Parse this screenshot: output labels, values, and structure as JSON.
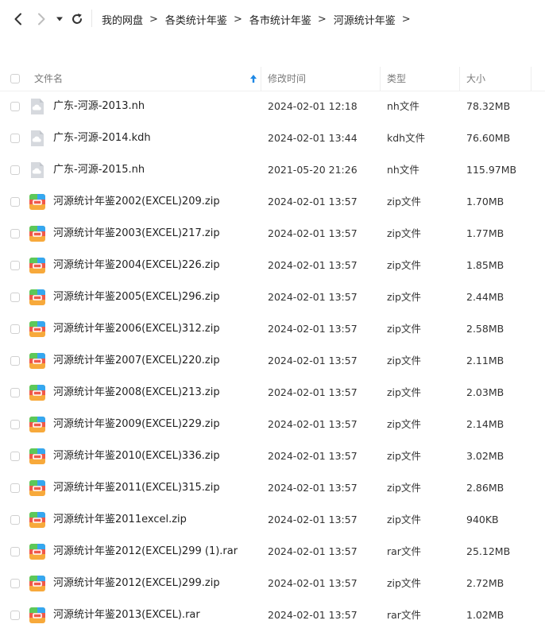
{
  "nav": {
    "back_icon": "chevron-left-icon",
    "forward_icon": "chevron-right-icon",
    "dropdown_icon": "caret-down-icon",
    "refresh_icon": "refresh-icon"
  },
  "breadcrumb": {
    "separator": ">",
    "items": [
      "我的网盘",
      "各类统计年鉴",
      "各市统计年鉴",
      "河源统计年鉴"
    ]
  },
  "columns": {
    "name": "文件名",
    "modified": "修改时间",
    "type": "类型",
    "size": "大小",
    "sort_icon": "sort-ascending-arrow-icon"
  },
  "colors": {
    "accent": "#1e88e5",
    "zip_icon_green": "#5cc85a",
    "zip_icon_red": "#f0594a",
    "zip_icon_blue": "#35a7f0",
    "zip_icon_orange": "#f7a93b",
    "generic_file_gray": "#d6d9de"
  },
  "files": [
    {
      "icon": "generic-file-icon",
      "name": "广东-河源-2013.nh",
      "modified": "2024-02-01 12:18",
      "type": "nh文件",
      "size": "78.32MB"
    },
    {
      "icon": "generic-file-icon",
      "name": "广东-河源-2014.kdh",
      "modified": "2024-02-01 13:44",
      "type": "kdh文件",
      "size": "76.60MB"
    },
    {
      "icon": "generic-file-icon",
      "name": "广东-河源-2015.nh",
      "modified": "2021-05-20 21:26",
      "type": "nh文件",
      "size": "115.97MB"
    },
    {
      "icon": "archive-file-icon",
      "name": "河源统计年鉴2002(EXCEL)209.zip",
      "modified": "2024-02-01 13:57",
      "type": "zip文件",
      "size": "1.70MB"
    },
    {
      "icon": "archive-file-icon",
      "name": "河源统计年鉴2003(EXCEL)217.zip",
      "modified": "2024-02-01 13:57",
      "type": "zip文件",
      "size": "1.77MB"
    },
    {
      "icon": "archive-file-icon",
      "name": "河源统计年鉴2004(EXCEL)226.zip",
      "modified": "2024-02-01 13:57",
      "type": "zip文件",
      "size": "1.85MB"
    },
    {
      "icon": "archive-file-icon",
      "name": "河源统计年鉴2005(EXCEL)296.zip",
      "modified": "2024-02-01 13:57",
      "type": "zip文件",
      "size": "2.44MB"
    },
    {
      "icon": "archive-file-icon",
      "name": "河源统计年鉴2006(EXCEL)312.zip",
      "modified": "2024-02-01 13:57",
      "type": "zip文件",
      "size": "2.58MB"
    },
    {
      "icon": "archive-file-icon",
      "name": "河源统计年鉴2007(EXCEL)220.zip",
      "modified": "2024-02-01 13:57",
      "type": "zip文件",
      "size": "2.11MB"
    },
    {
      "icon": "archive-file-icon",
      "name": "河源统计年鉴2008(EXCEL)213.zip",
      "modified": "2024-02-01 13:57",
      "type": "zip文件",
      "size": "2.03MB"
    },
    {
      "icon": "archive-file-icon",
      "name": "河源统计年鉴2009(EXCEL)229.zip",
      "modified": "2024-02-01 13:57",
      "type": "zip文件",
      "size": "2.14MB"
    },
    {
      "icon": "archive-file-icon",
      "name": "河源统计年鉴2010(EXCEL)336.zip",
      "modified": "2024-02-01 13:57",
      "type": "zip文件",
      "size": "3.02MB"
    },
    {
      "icon": "archive-file-icon",
      "name": "河源统计年鉴2011(EXCEL)315.zip",
      "modified": "2024-02-01 13:57",
      "type": "zip文件",
      "size": "2.86MB"
    },
    {
      "icon": "archive-file-icon",
      "name": "河源统计年鉴2011excel.zip",
      "modified": "2024-02-01 13:57",
      "type": "zip文件",
      "size": "940KB"
    },
    {
      "icon": "archive-file-icon",
      "name": "河源统计年鉴2012(EXCEL)299 (1).rar",
      "modified": "2024-02-01 13:57",
      "type": "rar文件",
      "size": "25.12MB"
    },
    {
      "icon": "archive-file-icon",
      "name": "河源统计年鉴2012(EXCEL)299.zip",
      "modified": "2024-02-01 13:57",
      "type": "zip文件",
      "size": "2.72MB"
    },
    {
      "icon": "archive-file-icon",
      "name": "河源统计年鉴2013(EXCEL).rar",
      "modified": "2024-02-01 13:57",
      "type": "rar文件",
      "size": "1.02MB"
    }
  ]
}
